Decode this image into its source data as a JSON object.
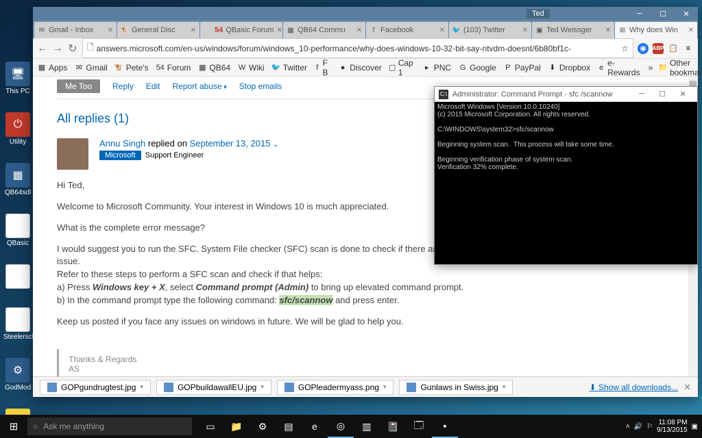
{
  "window_user": "Ted",
  "tabs": [
    {
      "label": "Gmail - Inbox",
      "fav": "✉"
    },
    {
      "label": "General Disc",
      "fav": "🐮"
    },
    {
      "count": "54",
      "label": "QBasic Forum",
      "fav": ""
    },
    {
      "label": "QB64 Commu",
      "fav": "▦"
    },
    {
      "label": "Facebook",
      "fav": "f"
    },
    {
      "label": "(103) Twitter",
      "fav": "🐦"
    },
    {
      "label": "Ted Weissger",
      "fav": "▣"
    },
    {
      "label": "Why does Win",
      "fav": "⊞",
      "active": true
    }
  ],
  "url": "answers.microsoft.com/en-us/windows/forum/windows_10-performance/why-does-windows-10-32-bit-say-ntvdm-doesnt/6b80bf1c-",
  "bookmarks": [
    {
      "icon": "▦",
      "label": "Apps"
    },
    {
      "icon": "✉",
      "label": "Gmail"
    },
    {
      "icon": "🐮",
      "label": "Pete's"
    },
    {
      "icon": "54",
      "label": "Forum"
    },
    {
      "icon": "▦",
      "label": "QB64"
    },
    {
      "icon": "W",
      "label": "Wiki"
    },
    {
      "icon": "🐦",
      "label": "Twitter"
    },
    {
      "icon": "f",
      "label": "F B"
    },
    {
      "icon": "●",
      "label": "Discover"
    },
    {
      "icon": "▢",
      "label": "Cap 1"
    },
    {
      "icon": "▸",
      "label": "PNC"
    },
    {
      "icon": "G",
      "label": "Google"
    },
    {
      "icon": "P",
      "label": "PayPal"
    },
    {
      "icon": "⬇",
      "label": "Dropbox"
    },
    {
      "icon": "e",
      "label": "e-Rewards"
    }
  ],
  "other_bookmarks": "Other bookmarks",
  "actions": {
    "me_too": "Me Too",
    "reply": "Reply",
    "edit": "Edit",
    "abuse": "Report abuse",
    "stop": "Stop emails"
  },
  "replies_title": "All replies (1)",
  "reply": {
    "author": "Annu Singh",
    "replied": "replied on",
    "date": "September 13, 2015",
    "badge": "Microsoft",
    "role": "Support Engineer"
  },
  "body": {
    "p1": "Hi Ted,",
    "p2": "Welcome to Microsoft Community. Your interest in Windows 10 is much appreciated.",
    "p3": "What is the complete error message?",
    "p4": "I would suggest you to run the SFC. System File checker (SFC) scan is done to check if there are any corrupted system files that could be causing this issue.",
    "p5": "Refer to these steps to perform a SFC scan and check if that helps:",
    "p6a": "a) Press ",
    "p6b": "Windows key + X",
    "p6c": ", select ",
    "p6d": "Command prompt (Admin)",
    "p6e": " to bring up elevated command prompt.",
    "p7a": "b) In the command prompt type the following command: ",
    "p7b": "sfc/scannow",
    "p7c": " and press enter.",
    "p8": "Keep us posted if you face any issues on windows in future. We will be glad to help you."
  },
  "signature": {
    "l1": "Thanks & Regards",
    "l2": "AS"
  },
  "cmd": {
    "title": "Administrator: Command Prompt - sfc /scannow",
    "l1": "Microsoft Windows [Version 10.0.10240]",
    "l2": "(c) 2015 Microsoft Corporation. All rights reserved.",
    "l3": "C:\\WINDOWS\\system32>sfc/scannow",
    "l4": "Beginning system scan.  This process will take some time.",
    "l5": "Beginning verification phase of system scan.",
    "l6": "Verification 32% complete."
  },
  "downloads": [
    "GOPgundrugtest.jpg",
    "GOPbuildawallEU.jpg",
    "GOPleadermyass.png",
    "Gunlaws in Swiss.jpg"
  ],
  "show_all": "Show all downloads...",
  "desktop": [
    {
      "label": "This PC",
      "cls": "blue",
      "icon": "🖥"
    },
    {
      "label": "Utility",
      "cls": "red",
      "icon": "⏻"
    },
    {
      "label": "QB64sdl",
      "cls": "blue",
      "icon": "▦"
    },
    {
      "label": "QBasic",
      "cls": "file",
      "icon": ""
    },
    {
      "label": "",
      "cls": "file",
      "icon": ""
    },
    {
      "label": "Steelersch",
      "cls": "file",
      "icon": ""
    },
    {
      "label": "GodMod",
      "cls": "blue",
      "icon": "⚙"
    },
    {
      "label": "",
      "cls": "folder",
      "icon": "📁"
    }
  ],
  "search_placeholder": "Ask me anything",
  "clock": {
    "time": "11:08 PM",
    "date": "9/13/2015"
  }
}
